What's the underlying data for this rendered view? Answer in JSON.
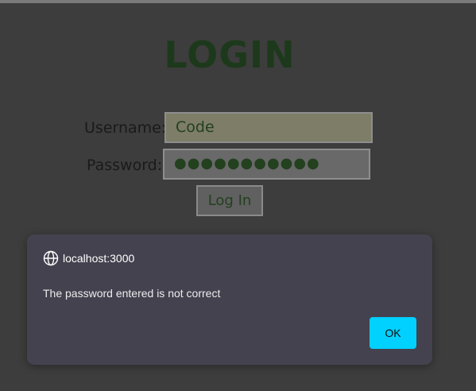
{
  "page": {
    "title": "LOGIN",
    "username_label": "Username:",
    "password_label": "Password:",
    "username_value": "Code",
    "password_value": "●●●●●●●●●●●",
    "login_button": "Log In"
  },
  "dialog": {
    "origin": "localhost:3000",
    "message": "The password entered is not correct",
    "ok_label": "OK",
    "icon": "globe-icon"
  },
  "colors": {
    "background": "#3d3d3d",
    "title": "#1d391b",
    "dialog_bg": "#44424f",
    "ok_button": "#00d1ff"
  }
}
